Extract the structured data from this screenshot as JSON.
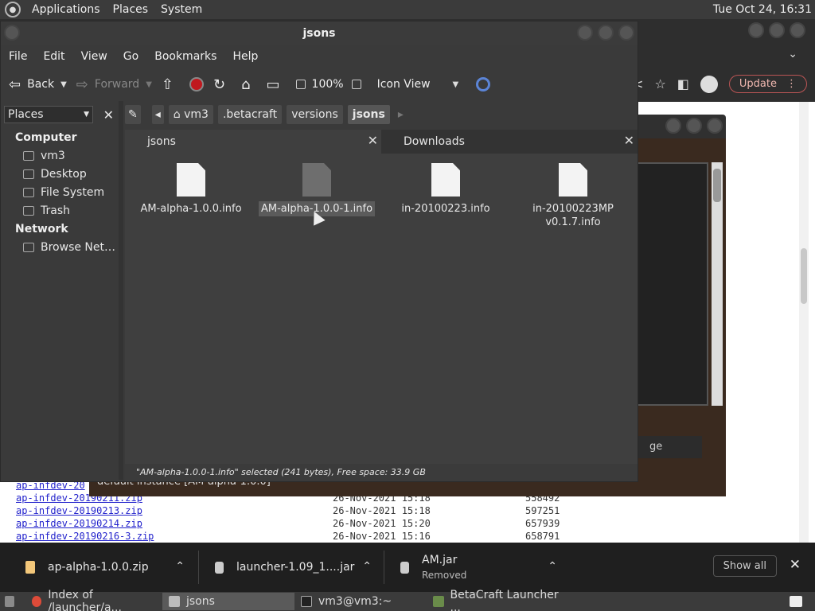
{
  "top_panel": {
    "menus": [
      "Applications",
      "Places",
      "System"
    ],
    "clock": "Tue Oct 24, 16:31"
  },
  "browser": {
    "update_label": "Update",
    "listing": [
      {
        "name": "ap-infdev-20",
        "date": "",
        "size": ""
      },
      {
        "name": "ap-infdev-20190211.zip",
        "date": "26-Nov-2021 15:18",
        "size": "558492"
      },
      {
        "name": "ap-infdev-20190213.zip",
        "date": "26-Nov-2021 15:18",
        "size": "597251"
      },
      {
        "name": "ap-infdev-20190214.zip",
        "date": "26-Nov-2021 15:20",
        "size": "657939"
      },
      {
        "name": "ap-infdev-20190216-3.zip",
        "date": "26-Nov-2021 15:16",
        "size": "658791"
      }
    ]
  },
  "downloads": {
    "items": [
      {
        "name": "ap-alpha-1.0.0.zip",
        "status": ""
      },
      {
        "name": "launcher-1.09_1....jar",
        "status": ""
      },
      {
        "name": "AM.jar",
        "status": "Removed"
      }
    ],
    "show_all": "Show all"
  },
  "launcher": {
    "status_text": "default instance [AM-alpha-1.0.0]",
    "button_label": "ge"
  },
  "file_manager": {
    "title": "jsons",
    "menus": [
      "File",
      "Edit",
      "View",
      "Go",
      "Bookmarks",
      "Help"
    ],
    "toolbar": {
      "back": "Back",
      "forward": "Forward",
      "zoom": "100%",
      "view_mode": "Icon View"
    },
    "sidebar": {
      "selector": "Places",
      "sections": [
        {
          "title": "Computer",
          "items": [
            "vm3",
            "Desktop",
            "File System",
            "Trash"
          ]
        },
        {
          "title": "Network",
          "items": [
            "Browse Net…"
          ]
        }
      ]
    },
    "breadcrumbs": [
      "vm3",
      ".betacraft",
      "versions",
      "jsons"
    ],
    "tabs": [
      {
        "label": "jsons",
        "active": true
      },
      {
        "label": "Downloads",
        "active": false
      }
    ],
    "files": [
      {
        "name": "AM-alpha-1.0.0.info",
        "selected": false
      },
      {
        "name": "AM-alpha-1.0.0-1.info",
        "selected": true
      },
      {
        "name": "in-20100223.info",
        "selected": false
      },
      {
        "name": "in-20100223MP v0.1.7.info",
        "selected": false
      }
    ],
    "status": "\"AM-alpha-1.0.0-1.info\" selected (241 bytes), Free space: 33.9 GB"
  },
  "taskbar": {
    "tasks": [
      {
        "label": "Index of /launcher/a...",
        "active": false
      },
      {
        "label": "jsons",
        "active": true
      },
      {
        "label": "vm3@vm3:~",
        "active": false
      },
      {
        "label": "BetaCraft Launcher ...",
        "active": false
      }
    ]
  },
  "colors": {
    "record_red": "#c0181e",
    "link_blue": "#2222cc",
    "search_blue": "#5b84d6"
  }
}
